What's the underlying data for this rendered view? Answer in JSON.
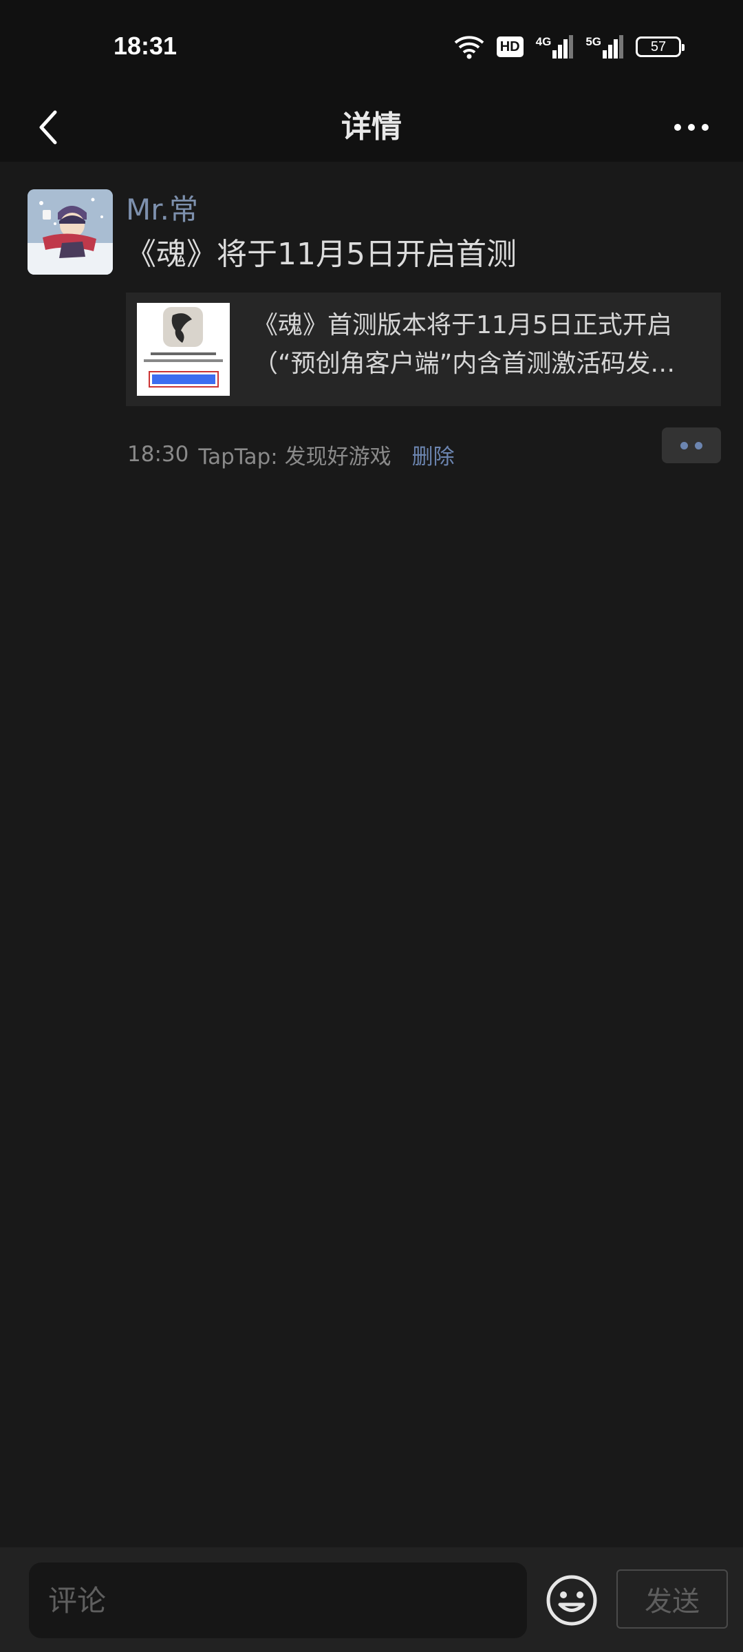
{
  "status_bar": {
    "time": "18:31",
    "hd_label": "HD",
    "net1_label": "4G",
    "net2_label": "5G",
    "battery": "57",
    "icons": [
      "wifi-icon",
      "hd-icon",
      "signal-4g-icon",
      "signal-5g-icon",
      "battery-icon"
    ]
  },
  "nav": {
    "title": "详情",
    "back_icon": "chevron-left-icon",
    "more_icon": "more-dots-icon"
  },
  "post": {
    "username": "Mr.常",
    "text": "《魂》将于11月5日开启首测",
    "link": {
      "line1": "《魂》首测版本将于11月5日正式开启",
      "line2": "（“预创角客户端”内含首测激活码发…"
    },
    "time": "18:30",
    "source": "TapTap: 发现好游戏",
    "delete_label": "删除"
  },
  "composer": {
    "placeholder": "评论",
    "send_label": "发送",
    "emoji_icon": "emoji-icon"
  },
  "colors": {
    "background": "#191919",
    "bar_background": "#111111",
    "accent_link": "#6c85b0",
    "username": "#7d90ad"
  }
}
